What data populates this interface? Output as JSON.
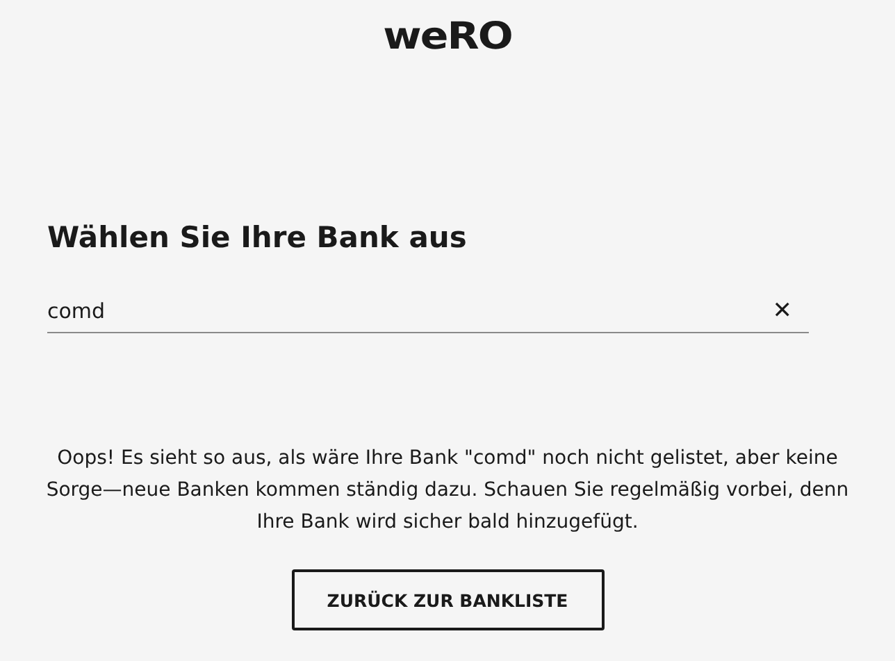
{
  "logo": {
    "text": "weRO"
  },
  "heading": "Wählen Sie Ihre Bank aus",
  "search": {
    "value": "comd",
    "clear_icon": "✕"
  },
  "message": "Oops! Es sieht so aus, als wäre Ihre Bank \"comd\" noch nicht gelistet, aber keine Sorge—neue Banken kommen ständig dazu. Schauen Sie regelmäßig vorbei, denn Ihre Bank wird sicher bald hinzugefügt.",
  "button": "ZURÜCK ZUR BANKLISTE"
}
